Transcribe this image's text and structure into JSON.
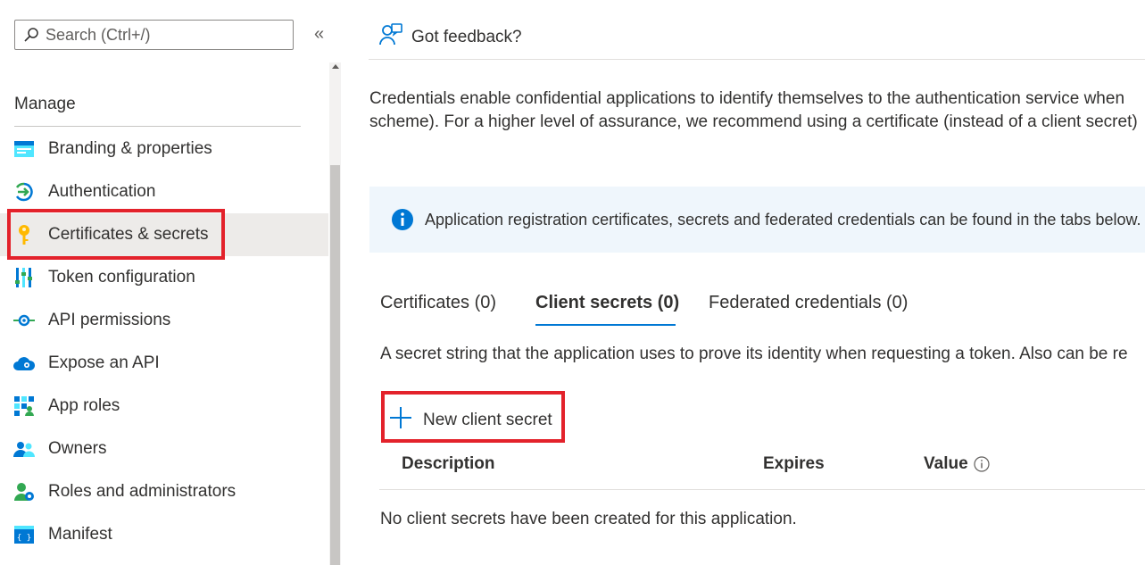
{
  "sidebar": {
    "search_placeholder": "Search (Ctrl+/)",
    "collapse_glyph": "«",
    "section_title": "Manage",
    "items": [
      {
        "label": "Branding & properties",
        "icon": "branding-icon"
      },
      {
        "label": "Authentication",
        "icon": "authentication-icon"
      },
      {
        "label": "Certificates & secrets",
        "icon": "key-icon",
        "active": true
      },
      {
        "label": "Token configuration",
        "icon": "token-config-icon"
      },
      {
        "label": "API permissions",
        "icon": "api-permissions-icon"
      },
      {
        "label": "Expose an API",
        "icon": "cloud-icon"
      },
      {
        "label": "App roles",
        "icon": "app-roles-icon"
      },
      {
        "label": "Owners",
        "icon": "owners-icon"
      },
      {
        "label": "Roles and administrators",
        "icon": "roles-admin-icon"
      },
      {
        "label": "Manifest",
        "icon": "manifest-icon"
      }
    ]
  },
  "header": {
    "feedback_label": "Got feedback?"
  },
  "main": {
    "description_line1": "Credentials enable confidential applications to identify themselves to the authentication service when",
    "description_line2": "scheme). For a higher level of assurance, we recommend using a certificate (instead of a client secret)",
    "info_text": "Application registration certificates, secrets and federated credentials can be found in the tabs below.",
    "tabs": [
      {
        "label": "Certificates (0)"
      },
      {
        "label": "Client secrets (0)",
        "active": true
      },
      {
        "label": "Federated credentials (0)"
      }
    ],
    "tab_description": "A secret string that the application uses to prove its identity when requesting a token. Also can be re",
    "new_secret_label": "New client secret",
    "table": {
      "columns": [
        "Description",
        "Expires",
        "Value"
      ],
      "empty_message": "No client secrets have been created for this application."
    }
  },
  "colors": {
    "accent": "#0078d4",
    "highlight_border": "#e3222b",
    "info_background": "#eff6fc",
    "active_nav_bg": "#edebe9"
  }
}
